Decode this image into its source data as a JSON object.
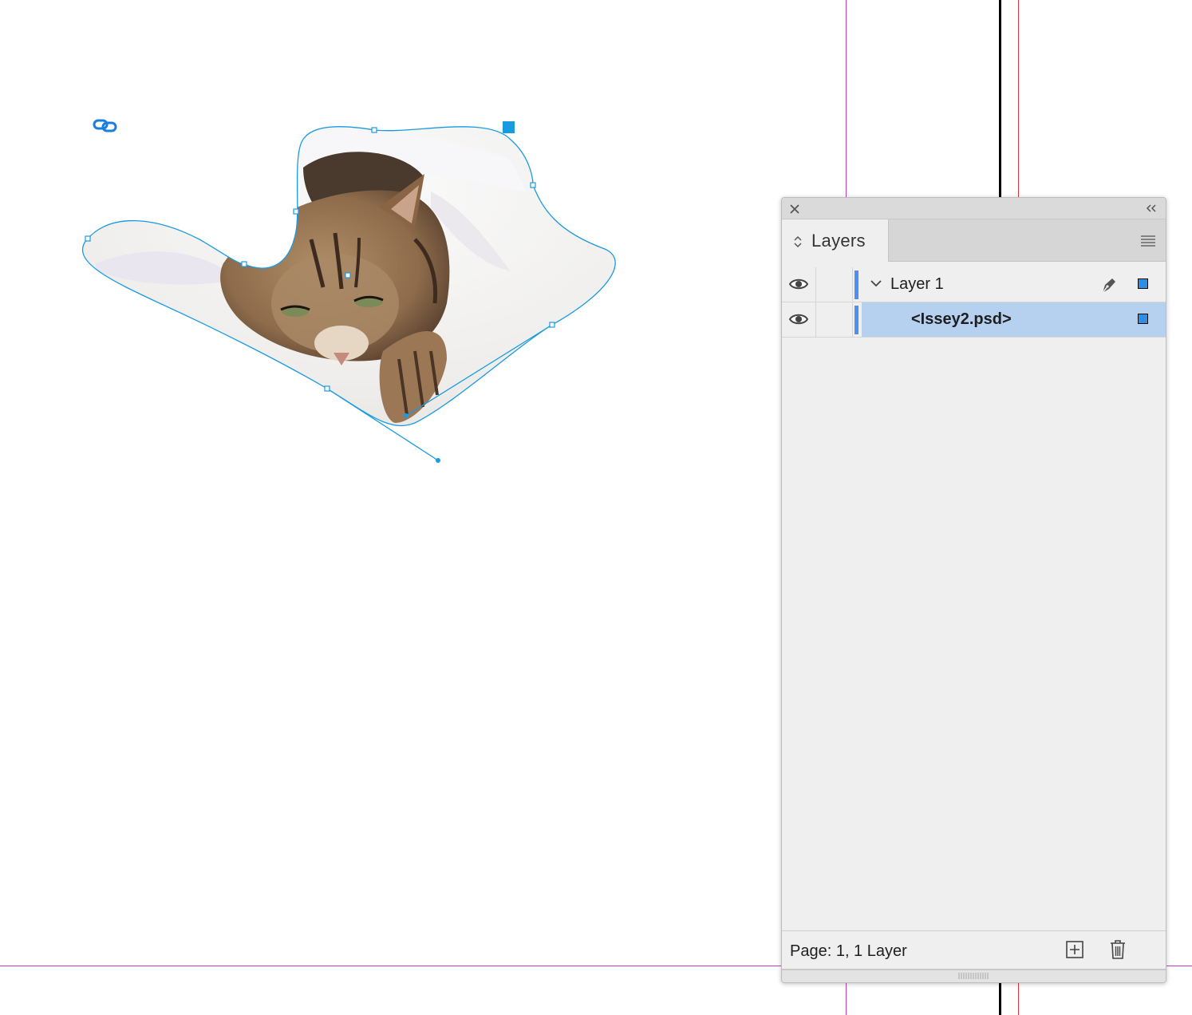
{
  "colors": {
    "margin_guide": "#c040c0",
    "bleed_guide": "#e0303c",
    "selection": "#1a9be0",
    "layer_color": "#4d90f0",
    "selected_row": "#b6d1f0"
  },
  "canvas": {
    "image_subject": "tabby cat lying in white blanket",
    "link_icon": "link-icon"
  },
  "panel": {
    "tab_label": "Layers",
    "close_icon": "close-icon",
    "collapse_icon": "collapse-icon",
    "menu_icon": "panel-menu-icon",
    "layers": [
      {
        "name": "Layer 1",
        "expanded": true,
        "visible": true,
        "target": true,
        "selected": false
      },
      {
        "name": "<Issey2.psd>",
        "visible": true,
        "selected": true
      }
    ],
    "footer": {
      "status": "Page: 1, 1 Layer",
      "new_layer_icon": "new-layer-icon",
      "delete_icon": "trash-icon"
    }
  }
}
